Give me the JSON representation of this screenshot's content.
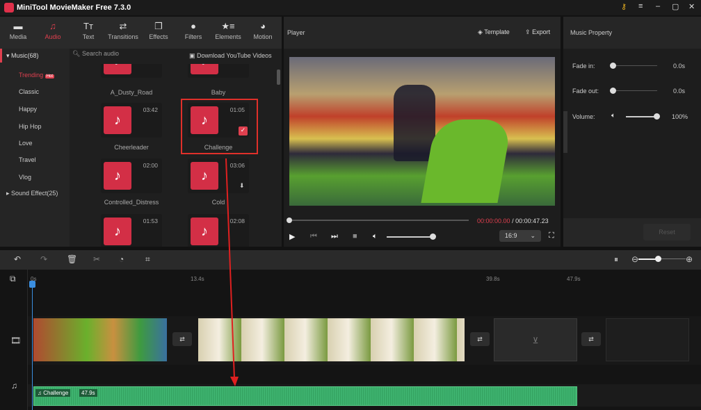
{
  "app": {
    "title": "MiniTool MovieMaker Free 7.3.0"
  },
  "toolbar": [
    {
      "label": "Media",
      "icon": "folder-icon"
    },
    {
      "label": "Audio",
      "icon": "music-icon",
      "active": true
    },
    {
      "label": "Text",
      "icon": "text-icon"
    },
    {
      "label": "Transitions",
      "icon": "transitions-icon"
    },
    {
      "label": "Effects",
      "icon": "effects-icon"
    },
    {
      "label": "Filters",
      "icon": "filters-icon"
    },
    {
      "label": "Elements",
      "icon": "elements-icon"
    },
    {
      "label": "Motion",
      "icon": "motion-icon"
    }
  ],
  "sidebar": {
    "music": "Music(68)",
    "items": [
      "Trending",
      "Classic",
      "Happy",
      "Hip Hop",
      "Love",
      "Travel",
      "Vlog"
    ],
    "hot": "Hot",
    "sound_effect": "Sound Effect(25)"
  },
  "search": {
    "placeholder": "Search audio"
  },
  "download": "Download YouTube Videos",
  "tracks": [
    {
      "name": "A_Dusty_Road",
      "duration": ""
    },
    {
      "name": "Baby",
      "duration": ""
    },
    {
      "name": "Cheerleader",
      "duration": "03:42"
    },
    {
      "name": "Challenge",
      "duration": "01:05",
      "selected": true
    },
    {
      "name": "Controlled_Distress",
      "duration": "02:00"
    },
    {
      "name": "Cold",
      "duration": "03:06"
    },
    {
      "name": "",
      "duration": "01:53"
    },
    {
      "name": "",
      "duration": "02:08"
    }
  ],
  "player": {
    "title": "Player",
    "template": "Template",
    "export": "Export",
    "current": "00:00:00.00",
    "total": "/ 00:00:47.23",
    "aspect": "16:9",
    "volume": 0.85,
    "progress": 0
  },
  "property": {
    "title": "Music Property",
    "fade_in_label": "Fade in:",
    "fade_in": "0.0s",
    "fade_out_label": "Fade out:",
    "fade_out": "0.0s",
    "volume_label": "Volume:",
    "volume": "100%",
    "reset": "Reset"
  },
  "timeline": {
    "ticks": [
      "0s",
      "13.4s",
      "39.8s",
      "47.9s"
    ],
    "audio_clip": {
      "name": "Challenge",
      "duration": "47.9s"
    },
    "accent": "#3cb56b"
  }
}
